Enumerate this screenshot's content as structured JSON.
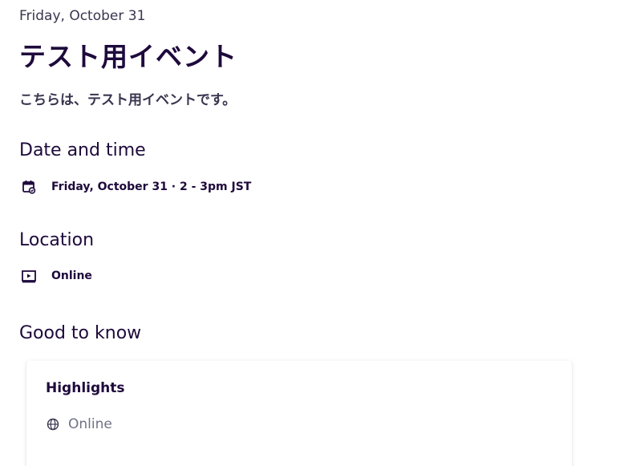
{
  "event": {
    "date_label": "Friday, October 31",
    "title": "テスト用イベント",
    "summary": "こちらは、テスト用イベントです。"
  },
  "date_and_time": {
    "heading": "Date and time",
    "icon": "calendar-icon",
    "value": "Friday, October 31 · 2 - 3pm JST"
  },
  "location": {
    "heading": "Location",
    "icon": "online-video-icon",
    "value": "Online"
  },
  "good_to_know": {
    "heading": "Good to know",
    "highlights": {
      "title": "Highlights",
      "items": [
        {
          "icon": "globe-icon",
          "label": "Online"
        }
      ]
    }
  }
}
